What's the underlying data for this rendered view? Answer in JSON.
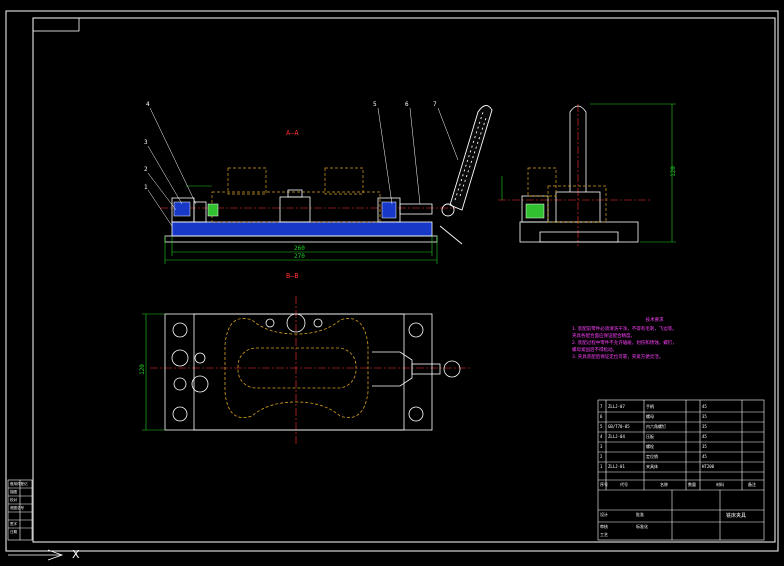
{
  "drawing": {
    "section_aa_label": "A—A",
    "section_bb_label": "B—B",
    "balloons": [
      "1",
      "2",
      "3",
      "4",
      "5",
      "6",
      "7"
    ],
    "dimension_overall": "270",
    "dimension_inner": "260",
    "dimension_side": "120",
    "dimension_plan": "120",
    "ucs_label": "X"
  },
  "tech_notes": {
    "title": "技术要求",
    "lines": [
      "1. 装配前零件必须清洗干净，不得有毛刺，飞边等。",
      "夹具各配合面应保证配合精度。",
      "2. 装配过程中零件不允许磕碰，划伤和锈蚀，螺钉，",
      "螺母紧固后不得松动。",
      "3. 夹具装配后保证定位可靠，夹紧方便灵活。"
    ]
  },
  "title_block": {
    "bom_rows": [
      {
        "no": "7",
        "code": "ZLLJ-07",
        "name": "手柄",
        "qty": "1",
        "material": "45"
      },
      {
        "no": "6",
        "code": "",
        "name": "螺母",
        "qty": "1",
        "material": "35"
      },
      {
        "no": "5",
        "code": "GB/T70-85",
        "name": "内六角螺钉",
        "qty": "4",
        "material": "35"
      },
      {
        "no": "4",
        "code": "ZLLJ-04",
        "name": "压板",
        "qty": "1",
        "material": "45"
      },
      {
        "no": "3",
        "code": "",
        "name": "螺栓",
        "qty": "2",
        "material": "35"
      },
      {
        "no": "2",
        "code": "",
        "name": "定位销",
        "qty": "2",
        "material": "45"
      },
      {
        "no": "1",
        "code": "ZLLJ-01",
        "name": "夹具体",
        "qty": "1",
        "material": "HT200"
      }
    ],
    "header_cells": [
      "序号",
      "代号",
      "名称",
      "数量",
      "材料",
      "备注"
    ],
    "drawing_name": "铣床夹具",
    "labels": [
      "设计",
      "审核",
      "工艺",
      "批准",
      "标准化"
    ]
  },
  "revision_strip": [
    "借用件登记",
    "描图",
    "校对",
    "底图总号",
    "签字",
    "日期"
  ],
  "colors": {
    "frame": "#ffffff",
    "part_outline": "#ffffff",
    "hidden_line": "#d8a020",
    "center_line": "#ff3030",
    "dimension": "#22d022",
    "hatch": "#3050ff",
    "notes": "#ff40ff"
  }
}
